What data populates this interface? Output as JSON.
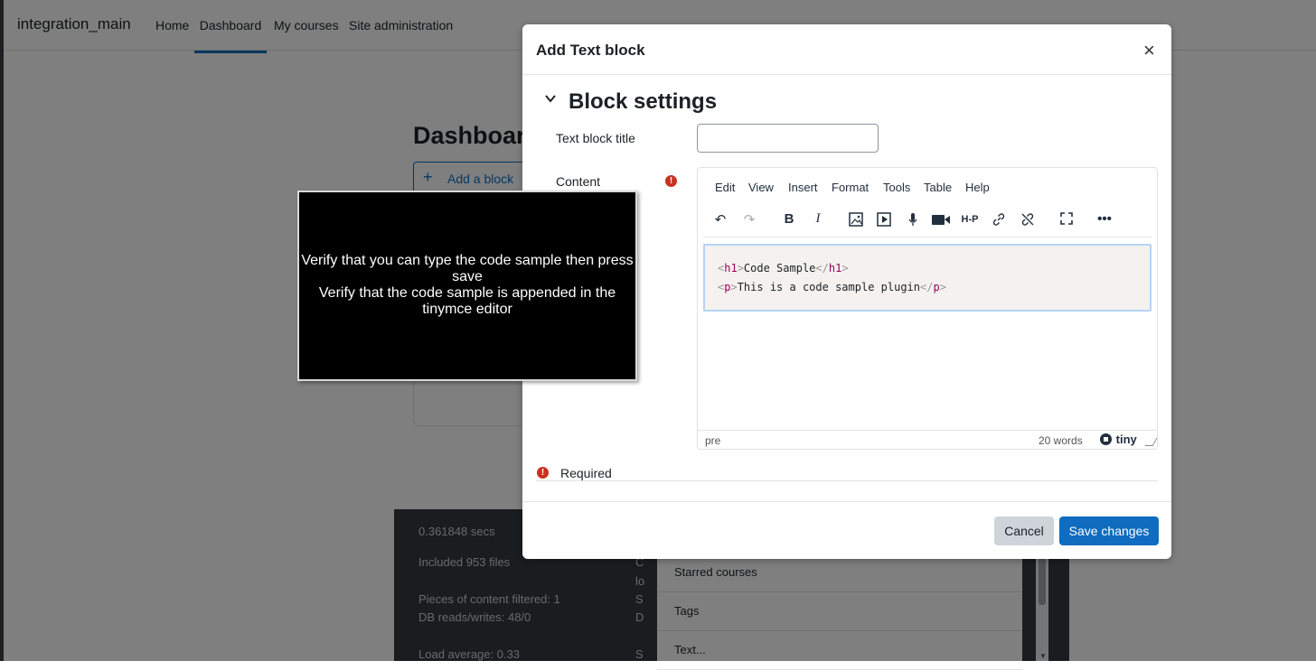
{
  "navbar": {
    "brand": "integration_main",
    "links": [
      "Home",
      "Dashboard",
      "My courses",
      "Site administration"
    ]
  },
  "dashboard": {
    "title": "Dashboard",
    "add_block_label": "Add a block"
  },
  "perf_footer": {
    "lines": [
      "0.361848 secs",
      "Included 953 files",
      "Pieces of content filtered: 1",
      "DB reads/writes: 48/0",
      "Load average: 0.33"
    ],
    "cut_letters": [
      "C",
      "lo",
      "S",
      "D",
      "S"
    ]
  },
  "block_list": {
    "items": [
      "Starred courses",
      "Tags",
      "Text..."
    ]
  },
  "modal": {
    "title": "Add Text block",
    "close_symbol": "×",
    "section_title": "Block settings",
    "title_field_label": "Text block title",
    "title_field_value": "",
    "content_label": "Content",
    "required_label": "Required",
    "cancel_label": "Cancel",
    "save_label": "Save changes"
  },
  "editor": {
    "menu": [
      "Edit",
      "View",
      "Insert",
      "Format",
      "Tools",
      "Table",
      "Help"
    ],
    "toolbar_icons": [
      "undo-icon",
      "redo-icon",
      "bold-icon",
      "italic-icon",
      "image-icon",
      "media-icon",
      "microphone-icon",
      "video-camera-icon",
      "h5p-icon",
      "link-icon",
      "unlink-icon",
      "fullscreen-icon",
      "more-icon"
    ],
    "code_line1": {
      "open_tag": "h1",
      "text": "Code Sample",
      "close_tag": "h1"
    },
    "code_line2": {
      "open_tag": "p",
      "text": "This is a code sample plugin",
      "close_tag": "p"
    },
    "status_path": "pre",
    "word_count": "20 words",
    "brand": "tiny"
  },
  "overlay": {
    "line1": "Verify that you can type the code sample then press save",
    "line2": "Verify that the code sample is appended in the tinymce editor"
  }
}
